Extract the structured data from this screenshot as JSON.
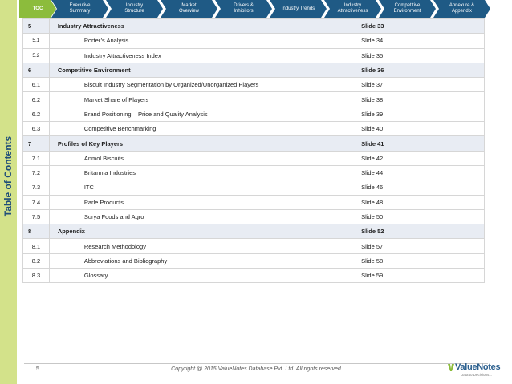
{
  "sidebar": {
    "title": "Table of Contents"
  },
  "nav": {
    "tabs": [
      {
        "lines": [
          "TOC"
        ],
        "active": true
      },
      {
        "lines": [
          "Executive",
          "Summary"
        ],
        "active": false
      },
      {
        "lines": [
          "Industry",
          "Structure"
        ],
        "active": false
      },
      {
        "lines": [
          "Market",
          "Overview"
        ],
        "active": false
      },
      {
        "lines": [
          "Drivers &",
          "Inhibitors"
        ],
        "active": false
      },
      {
        "lines": [
          "Industry Trends"
        ],
        "active": false
      },
      {
        "lines": [
          "Industry",
          "Attractiveness"
        ],
        "active": false
      },
      {
        "lines": [
          "Competitive",
          "Environment"
        ],
        "active": false
      },
      {
        "lines": [
          "Annexure &",
          "Appendix"
        ],
        "active": false
      }
    ]
  },
  "toc": {
    "rows": [
      {
        "num": "5",
        "title": "Industry Attractiveness",
        "slide": "Slide 33",
        "type": "section"
      },
      {
        "num": "5.1",
        "title": "Porter’s Analysis",
        "slide": "Slide 34",
        "type": "sub-small"
      },
      {
        "num": "5.2",
        "title": "Industry Attractiveness Index",
        "slide": "Slide 35",
        "type": "sub-small"
      },
      {
        "num": "6",
        "title": "Competitive Environment",
        "slide": "Slide 36",
        "type": "section"
      },
      {
        "num": "6.1",
        "title": "Biscuit Industry Segmentation by Organized/Unorganized Players",
        "slide": "Slide 37",
        "type": "sub"
      },
      {
        "num": "6.2",
        "title": "Market Share of Players",
        "slide": "Slide 38",
        "type": "sub"
      },
      {
        "num": "6.2",
        "title": "Brand Positioning – Price and Quality Analysis",
        "slide": "Slide 39",
        "type": "sub"
      },
      {
        "num": "6.3",
        "title": "Competitive Benchmarking",
        "slide": "Slide 40",
        "type": "sub"
      },
      {
        "num": "7",
        "title": "Profiles of Key Players",
        "slide": "Slide 41",
        "type": "section"
      },
      {
        "num": "7.1",
        "title": "Anmol Biscuits",
        "slide": "Slide 42",
        "type": "sub"
      },
      {
        "num": "7.2",
        "title": "Britannia Industries",
        "slide": "Slide 44",
        "type": "sub"
      },
      {
        "num": "7.3",
        "title": "ITC",
        "slide": "Slide 46",
        "type": "sub"
      },
      {
        "num": "7.4",
        "title": "Parle Products",
        "slide": "Slide 48",
        "type": "sub"
      },
      {
        "num": "7.5",
        "title": "Surya Foods and Agro",
        "slide": "Slide 50",
        "type": "sub"
      },
      {
        "num": "8",
        "title": "Appendix",
        "slide": "Slide 52",
        "type": "section"
      },
      {
        "num": "8.1",
        "title": "Research Methodology",
        "slide": "Slide 57",
        "type": "sub"
      },
      {
        "num": "8.2",
        "title": " Abbreviations and Bibliography",
        "slide": "Slide 58",
        "type": "sub"
      },
      {
        "num": "8.3",
        "title": "Glossary",
        "slide": "Slide 59",
        "type": "sub"
      }
    ]
  },
  "footer": {
    "page": "5",
    "copyright": "Copyright @ 2015 ValueNotes Database Pvt. Ltd. All rights reserved",
    "logo_name": "ValueNotes",
    "logo_tagline": "Data to Decisions...",
    "logo_color": "#2b5f8e"
  },
  "colors": {
    "nav_tab": "#1f5a85",
    "nav_active": "#8cbc3c",
    "sidebar": "#d3e28a",
    "section_row": "#e8ecf3"
  }
}
